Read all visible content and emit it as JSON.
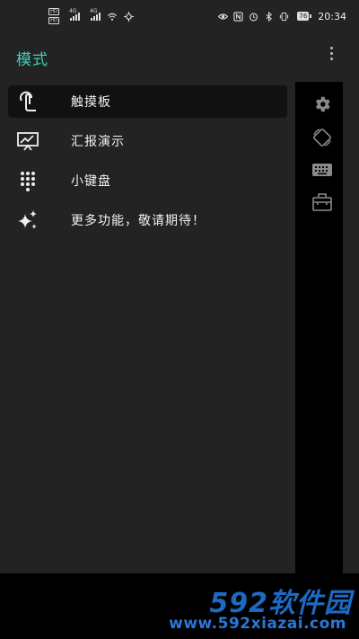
{
  "status_bar": {
    "hd1": "HD",
    "hd2": "HD",
    "net1": "4G",
    "net2": "4G",
    "battery": "76",
    "time": "20:34"
  },
  "drawer": {
    "title": "模式",
    "items": [
      {
        "label": "触摸板",
        "icon": "touch-gesture-icon",
        "active": true
      },
      {
        "label": "汇报演示",
        "icon": "presentation-icon",
        "active": false
      },
      {
        "label": "小键盘",
        "icon": "dialpad-icon",
        "active": false
      },
      {
        "label": "更多功能，敬请期待！",
        "icon": "sparkle-icon",
        "active": false
      }
    ]
  },
  "toolbar": {
    "icons": [
      "gear-icon",
      "rotate-screen-icon",
      "keyboard-icon",
      "toolbox-icon"
    ]
  },
  "watermark": {
    "brand": "592软件园",
    "url": "www.592xiazai.com"
  },
  "colors": {
    "accent": "#3fd0b8",
    "panel": "#232323",
    "watermark": "#1d6ac4"
  }
}
